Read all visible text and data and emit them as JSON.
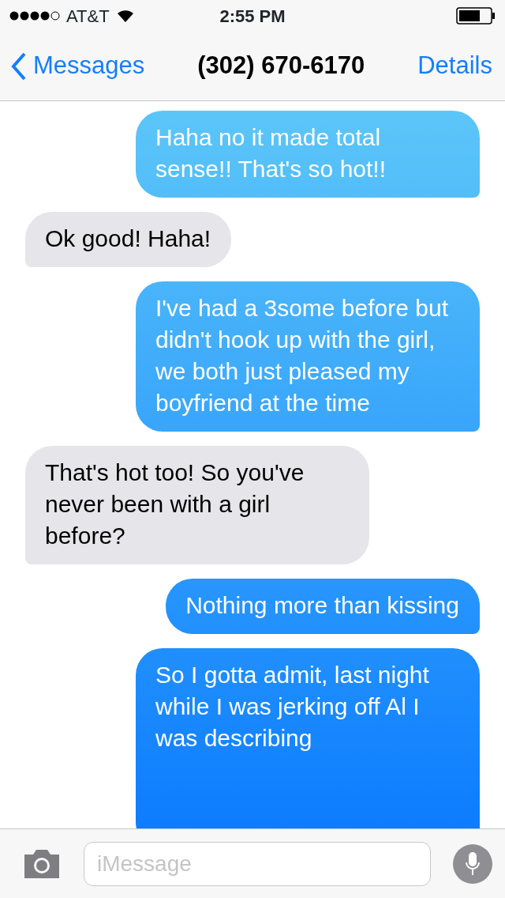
{
  "status_bar": {
    "carrier": "AT&T",
    "time": "2:55 PM"
  },
  "nav": {
    "back": "Messages",
    "title": "(302) 670-6170",
    "action": "Details"
  },
  "messages": [
    {
      "kind": "sent",
      "text": "Haha no it made total sense!! That's so hot!!"
    },
    {
      "kind": "received",
      "text": "Ok good! Haha!"
    },
    {
      "kind": "sent",
      "text": "I've had a 3some before but didn't hook up with the girl, we both just pleased my boyfriend at the time"
    },
    {
      "kind": "received",
      "text": "That's hot too! So you've never been with a girl before?"
    },
    {
      "kind": "sent",
      "text": "Nothing more than kissing"
    },
    {
      "kind": "sent",
      "text": "So I gotta admit, last night while I was jerking off Al I was describing"
    }
  ],
  "composer": {
    "placeholder": "iMessage"
  }
}
